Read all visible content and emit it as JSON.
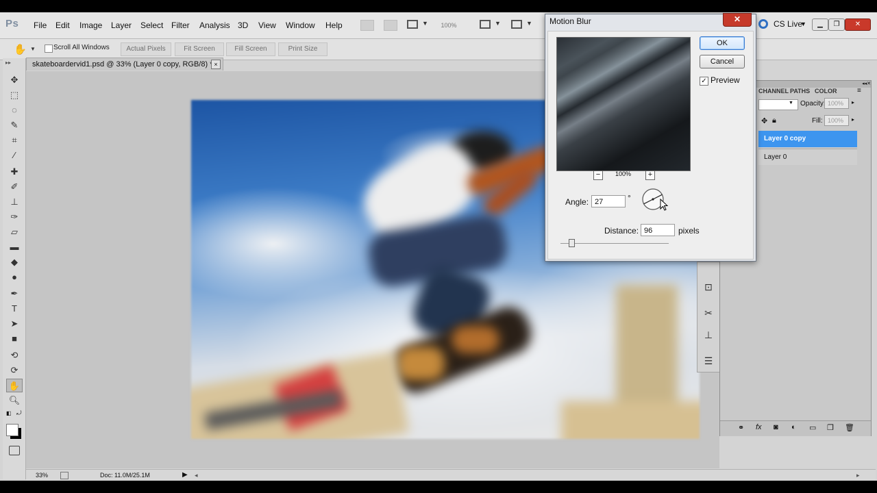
{
  "app": {
    "logo": "Ps",
    "cs_live": "CS Live",
    "zoom_display": "100%"
  },
  "menu": [
    "File",
    "Edit",
    "Image",
    "Layer",
    "Select",
    "Filter",
    "Analysis",
    "3D",
    "View",
    "Window",
    "Help"
  ],
  "options_bar": {
    "scroll_all_label": "Scroll All Windows",
    "buttons": [
      "Actual Pixels",
      "Fit Screen",
      "Fill Screen",
      "Print Size"
    ]
  },
  "document": {
    "tab_title": "skateboardervid1.psd @ 33% (Layer 0 copy, RGB/8) *",
    "close": "×"
  },
  "status": {
    "zoom": "33%",
    "doc": "Doc: 11.0M/25.1M"
  },
  "layers_panel": {
    "tabs": [
      "CHANNEL",
      "PATHS",
      "COLOR"
    ],
    "opacity_label": "Opacity:",
    "opacity_value": "100%",
    "fill_label": "Fill:",
    "fill_value": "100%",
    "layers": [
      {
        "name": "Layer 0 copy",
        "selected": true
      },
      {
        "name": "Layer 0",
        "selected": false
      }
    ]
  },
  "dialog": {
    "title": "Motion Blur",
    "close": "✕",
    "ok": "OK",
    "cancel": "Cancel",
    "preview_label": "Preview",
    "preview_checked": true,
    "zoom_minus": "−",
    "zoom_value": "100%",
    "zoom_plus": "+",
    "angle_label": "Angle:",
    "angle_value": "27",
    "degree_symbol": "°",
    "distance_label": "Distance:",
    "distance_value": "96",
    "distance_unit": "pixels",
    "distance_slider_fraction": 0.1
  },
  "colors": {
    "selection_blue": "#3d95ef",
    "close_red": "#c63a2b"
  }
}
